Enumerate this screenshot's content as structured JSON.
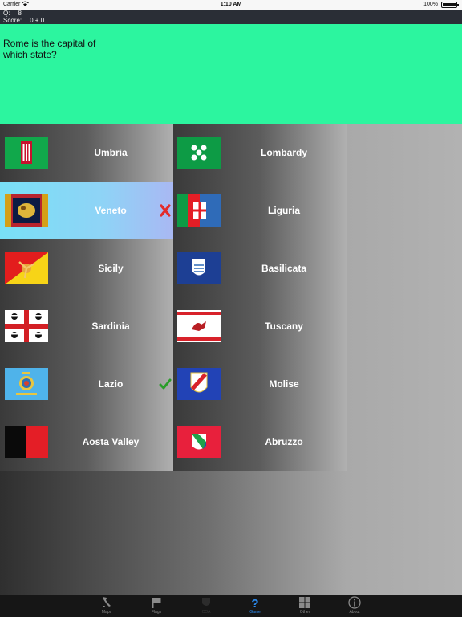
{
  "status_bar": {
    "carrier": "Carrier",
    "time": "1:10 AM",
    "battery": "100%"
  },
  "info": {
    "question_label": "Q:",
    "question_number": "8",
    "score_label": "Score:",
    "score_value": "0 + 0"
  },
  "question_text": "Rome is the capital of which state?",
  "answers_left": [
    {
      "label": "Umbria",
      "flag": "umbria-flag",
      "state": "normal"
    },
    {
      "label": "Veneto",
      "flag": "veneto-flag",
      "state": "wrong"
    },
    {
      "label": "Sicily",
      "flag": "sicily-flag",
      "state": "normal"
    },
    {
      "label": "Sardinia",
      "flag": "sardinia-flag",
      "state": "normal"
    },
    {
      "label": "Lazio",
      "flag": "lazio-flag",
      "state": "correct"
    },
    {
      "label": "Aosta Valley",
      "flag": "aosta-valley-flag",
      "state": "normal"
    }
  ],
  "answers_right": [
    {
      "label": "Lombardy",
      "flag": "lombardy-flag"
    },
    {
      "label": "Liguria",
      "flag": "liguria-flag"
    },
    {
      "label": "Basilicata",
      "flag": "basilicata-flag"
    },
    {
      "label": "Tuscany",
      "flag": "tuscany-flag"
    },
    {
      "label": "Molise",
      "flag": "molise-flag"
    },
    {
      "label": "Abruzzo",
      "flag": "abruzzo-flag"
    }
  ],
  "tabs": [
    {
      "label": "Maps",
      "icon": "italy-map-icon",
      "state": "normal"
    },
    {
      "label": "Flags",
      "icon": "flag-icon",
      "state": "normal"
    },
    {
      "label": "COA",
      "icon": "coat-of-arms-icon",
      "state": "disabled"
    },
    {
      "label": "Game",
      "icon": "question-mark-icon",
      "state": "active"
    },
    {
      "label": "Other",
      "icon": "grid-icon",
      "state": "normal"
    },
    {
      "label": "About",
      "icon": "info-icon",
      "state": "normal"
    }
  ],
  "colors": {
    "question_background": "#2cf59f",
    "info_bar": "#2a2e36",
    "wrong_highlight": "#8fd3f6",
    "tab_active": "#2b8cf3",
    "wrong_mark": "#e32b2b",
    "correct_mark": "#2a9d2a"
  }
}
